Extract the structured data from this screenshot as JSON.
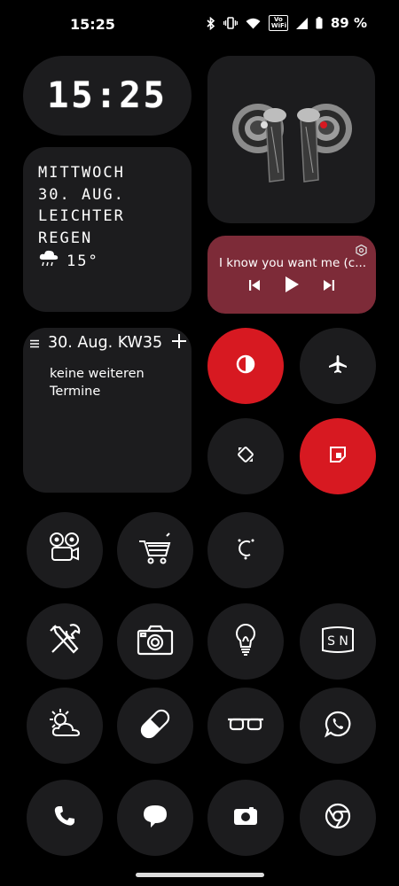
{
  "status_bar": {
    "time": "15:25",
    "battery_text": "89 %",
    "vowifi_top": "Vo",
    "vowifi_bottom": "WiFi"
  },
  "clock_widget": {
    "time": "15:25"
  },
  "weather_widget": {
    "day": "MITTWOCH",
    "date": "30. AUG.",
    "condition_line1": "LEICHTER",
    "condition_line2": "REGEN",
    "temperature": "15°"
  },
  "media_widget": {
    "title": "I know you want me (c...",
    "accent_color": "#7d2b38"
  },
  "calendar_widget": {
    "header": "30. Aug. KW35",
    "body": "keine weiteren Termine",
    "divider_color": "#4a7fa8"
  },
  "quick_tiles": [
    {
      "icon": "contrast-icon",
      "active": true
    },
    {
      "icon": "airplane-icon",
      "active": false
    },
    {
      "icon": "auto-rotate-icon",
      "active": false
    },
    {
      "icon": "screenshot-icon",
      "active": true
    }
  ],
  "app_icons": [
    "film-projector-icon",
    "shopping-cart-icon",
    "assistant-icon",
    "tools-icon",
    "camera-icon",
    "lightbulb-icon",
    "sn-note-icon",
    "weather-icon",
    "pill-icon",
    "glasses-icon",
    "whatsapp-icon",
    "phone-icon",
    "messages-icon",
    "camera-app-icon",
    "chrome-icon"
  ],
  "colors": {
    "background": "#000000",
    "tile": "#1c1c1e",
    "active_red": "#d71921"
  }
}
